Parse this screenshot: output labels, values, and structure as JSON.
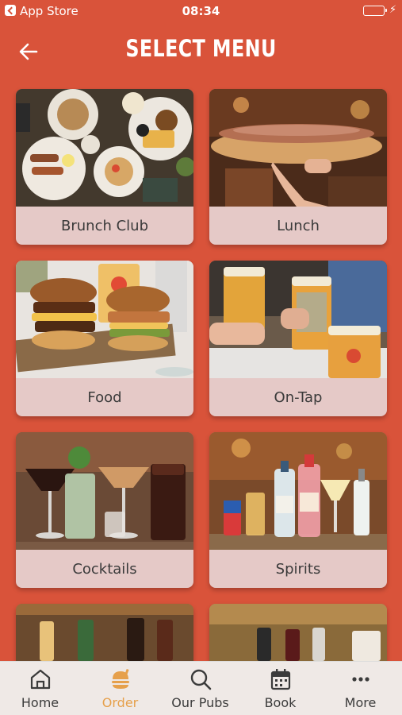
{
  "status_bar": {
    "back_app": "App Store",
    "time": "08:34"
  },
  "header": {
    "title": "SELECT MENU"
  },
  "menus": [
    {
      "label": "Brunch Club",
      "image": "brunch-photo"
    },
    {
      "label": "Lunch",
      "image": "lunch-photo"
    },
    {
      "label": "Food",
      "image": "food-photo"
    },
    {
      "label": "On-Tap",
      "image": "on-tap-photo"
    },
    {
      "label": "Cocktails",
      "image": "cocktails-photo"
    },
    {
      "label": "Spirits",
      "image": "spirits-photo"
    }
  ],
  "tab_bar": {
    "items": [
      {
        "label": "Home",
        "icon": "home-icon",
        "active": false
      },
      {
        "label": "Order",
        "icon": "order-icon",
        "active": true
      },
      {
        "label": "Our Pubs",
        "icon": "search-icon",
        "active": false
      },
      {
        "label": "Book",
        "icon": "calendar-icon",
        "active": false
      },
      {
        "label": "More",
        "icon": "more-icon",
        "active": false
      }
    ]
  },
  "colors": {
    "background": "#d9533a",
    "card_label_bg": "#e5c9c7",
    "tab_bar_bg": "#efe9e6",
    "active_tab": "#e6a04b"
  }
}
